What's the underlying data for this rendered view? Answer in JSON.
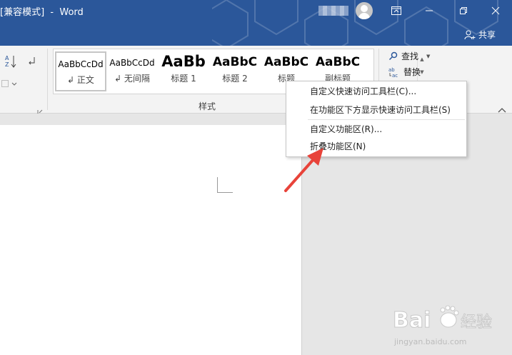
{
  "titlebar": {
    "title": "[兼容模式]  -  Word",
    "colors": {
      "background": "#2b579a"
    },
    "buttons": {
      "ribbon_display": "ribbon-display-icon",
      "restore": "restore-icon",
      "close": "close-icon"
    },
    "share_label": "共享"
  },
  "ribbon": {
    "styles_group_label": "样式",
    "styles": [
      {
        "sample": "AaBbCcDd",
        "name": "正文",
        "selected": true
      },
      {
        "sample": "AaBbCcDd",
        "name": "无间隔",
        "selected": false
      },
      {
        "sample": "AaBb",
        "name": "标题 1",
        "selected": false
      },
      {
        "sample": "AaBbC",
        "name": "标题 2",
        "selected": false
      },
      {
        "sample": "AaBbC",
        "name": "标题",
        "selected": false
      },
      {
        "sample": "AaBbC",
        "name": "副标题",
        "selected": false
      }
    ],
    "editing": {
      "find_label": "查找",
      "replace_label": "替换"
    }
  },
  "context_menu": {
    "items": [
      {
        "label": "自定义快速访问工具栏(C)..."
      },
      {
        "label": "在功能区下方显示快速访问工具栏(S)"
      },
      {
        "label": "自定义功能区(R)..."
      },
      {
        "label": "折叠功能区(N)"
      }
    ]
  },
  "watermark": {
    "brand": "Bai",
    "brand_cn": "经验",
    "url": "jingyan.baidu.com"
  }
}
